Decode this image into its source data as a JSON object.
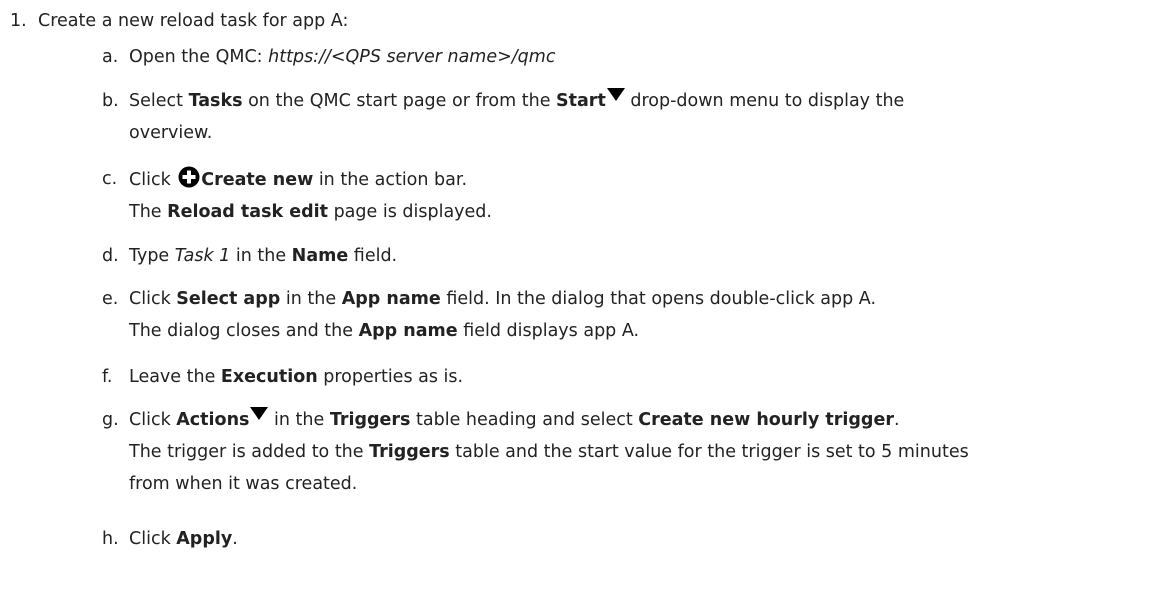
{
  "step1": {
    "number": "1.",
    "text": "Create a new reload task for app A:"
  },
  "substeps": {
    "a": {
      "letter": "a.",
      "text1": "Open the QMC: ",
      "url": "https://<QPS server name>/qmc"
    },
    "b": {
      "letter": "b.",
      "text1": "Select ",
      "bold1": "Tasks",
      "text2": " on the QMC start page or from the ",
      "bold2": "Start",
      "text3": " drop-down menu to display the",
      "line2": "overview."
    },
    "c": {
      "letter": "c.",
      "text1": "Click ",
      "bold1": "Create new",
      "text2": " in the action bar.",
      "line2_text1": "The ",
      "line2_bold": "Reload task edit",
      "line2_text2": " page is displayed."
    },
    "d": {
      "letter": "d.",
      "text1": "Type ",
      "italic1": "Task 1",
      "text2": " in the ",
      "bold1": "Name",
      "text3": " field."
    },
    "e": {
      "letter": "e.",
      "text1": "Click ",
      "bold1": "Select app",
      "text2": " in the ",
      "bold2": "App name",
      "text3": " field. In the dialog that opens double-click app A.",
      "line2_text1": "The dialog closes and the ",
      "line2_bold": "App name",
      "line2_text2": " field displays app A."
    },
    "f": {
      "letter": "f.",
      "text1": "Leave the ",
      "bold1": "Execution",
      "text2": " properties as is."
    },
    "g": {
      "letter": "g.",
      "text1": "Click ",
      "bold1": "Actions",
      "text2": " in the ",
      "bold2": "Triggers",
      "text3": " table heading and select ",
      "bold3": "Create new hourly trigger",
      "text4": ".",
      "line2_text1": "The trigger is added to the ",
      "line2_bold": "Triggers",
      "line2_text2": " table and the start value for the trigger is set to 5 minutes",
      "line3": "from when it was created."
    },
    "h": {
      "letter": "h.",
      "text1": "Click ",
      "bold1": "Apply",
      "text2": "."
    }
  },
  "icons": {
    "dropdown": "caret-down-icon",
    "create": "plus-circle-icon"
  }
}
